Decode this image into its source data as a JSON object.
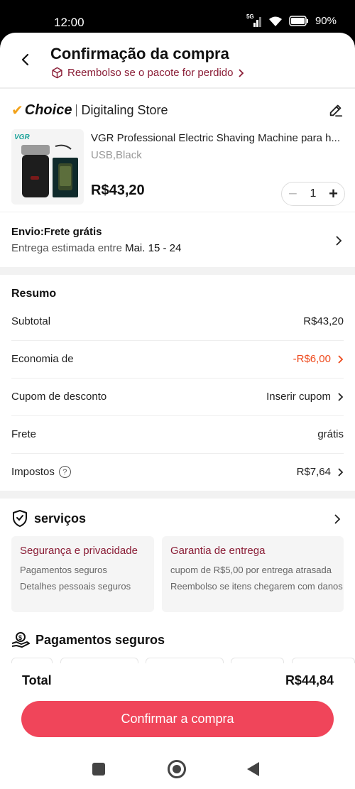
{
  "status_bar": {
    "time": "12:00",
    "network": "5G",
    "battery": "90%"
  },
  "header": {
    "title": "Confirmação da compra",
    "refund_link": "Reembolso se o pacote for perdido",
    "refund_icon": "package-icon"
  },
  "store": {
    "badge": "Choice",
    "name": "Digitaling Store"
  },
  "product": {
    "name": "VGR Professional Electric Shaving Machine para h...",
    "variant": "USB,Black",
    "price": "R$43,20",
    "quantity": "1",
    "brand_mark": "VGR"
  },
  "shipping": {
    "title": "Envio:Frete grátis",
    "estimate_prefix": "Entrega estimada entre ",
    "estimate_dates": "Mai. 15 - 24"
  },
  "summary": {
    "title": "Resumo",
    "rows": [
      {
        "label": "Subtotal",
        "value": "R$43,20"
      },
      {
        "label": "Economia de",
        "value": "-R$6,00"
      },
      {
        "label": "Cupom de desconto",
        "value": "Inserir cupom"
      },
      {
        "label": "Frete",
        "value": "grátis"
      },
      {
        "label": "Impostos",
        "value": "R$7,64"
      }
    ]
  },
  "services": {
    "title": "serviços",
    "cards": [
      {
        "title": "Segurança e privacidade",
        "lines": [
          "Pagamentos seguros",
          "Detalhes pessoais seguros"
        ]
      },
      {
        "title": "Garantia de entrega",
        "lines": [
          "cupom de R$5,00 por entrega atrasada",
          "Reembolso se itens chegarem com danos"
        ]
      }
    ]
  },
  "payments": {
    "title": "Pagamentos seguros"
  },
  "footer": {
    "total_label": "Total",
    "total_value": "R$44,84",
    "confirm_label": "Confirmar a compra"
  },
  "colors": {
    "accent": "#f0455a",
    "discount": "#ee4a1d",
    "brand_dark": "#8a1d36",
    "choice_check": "#f2a21a"
  }
}
